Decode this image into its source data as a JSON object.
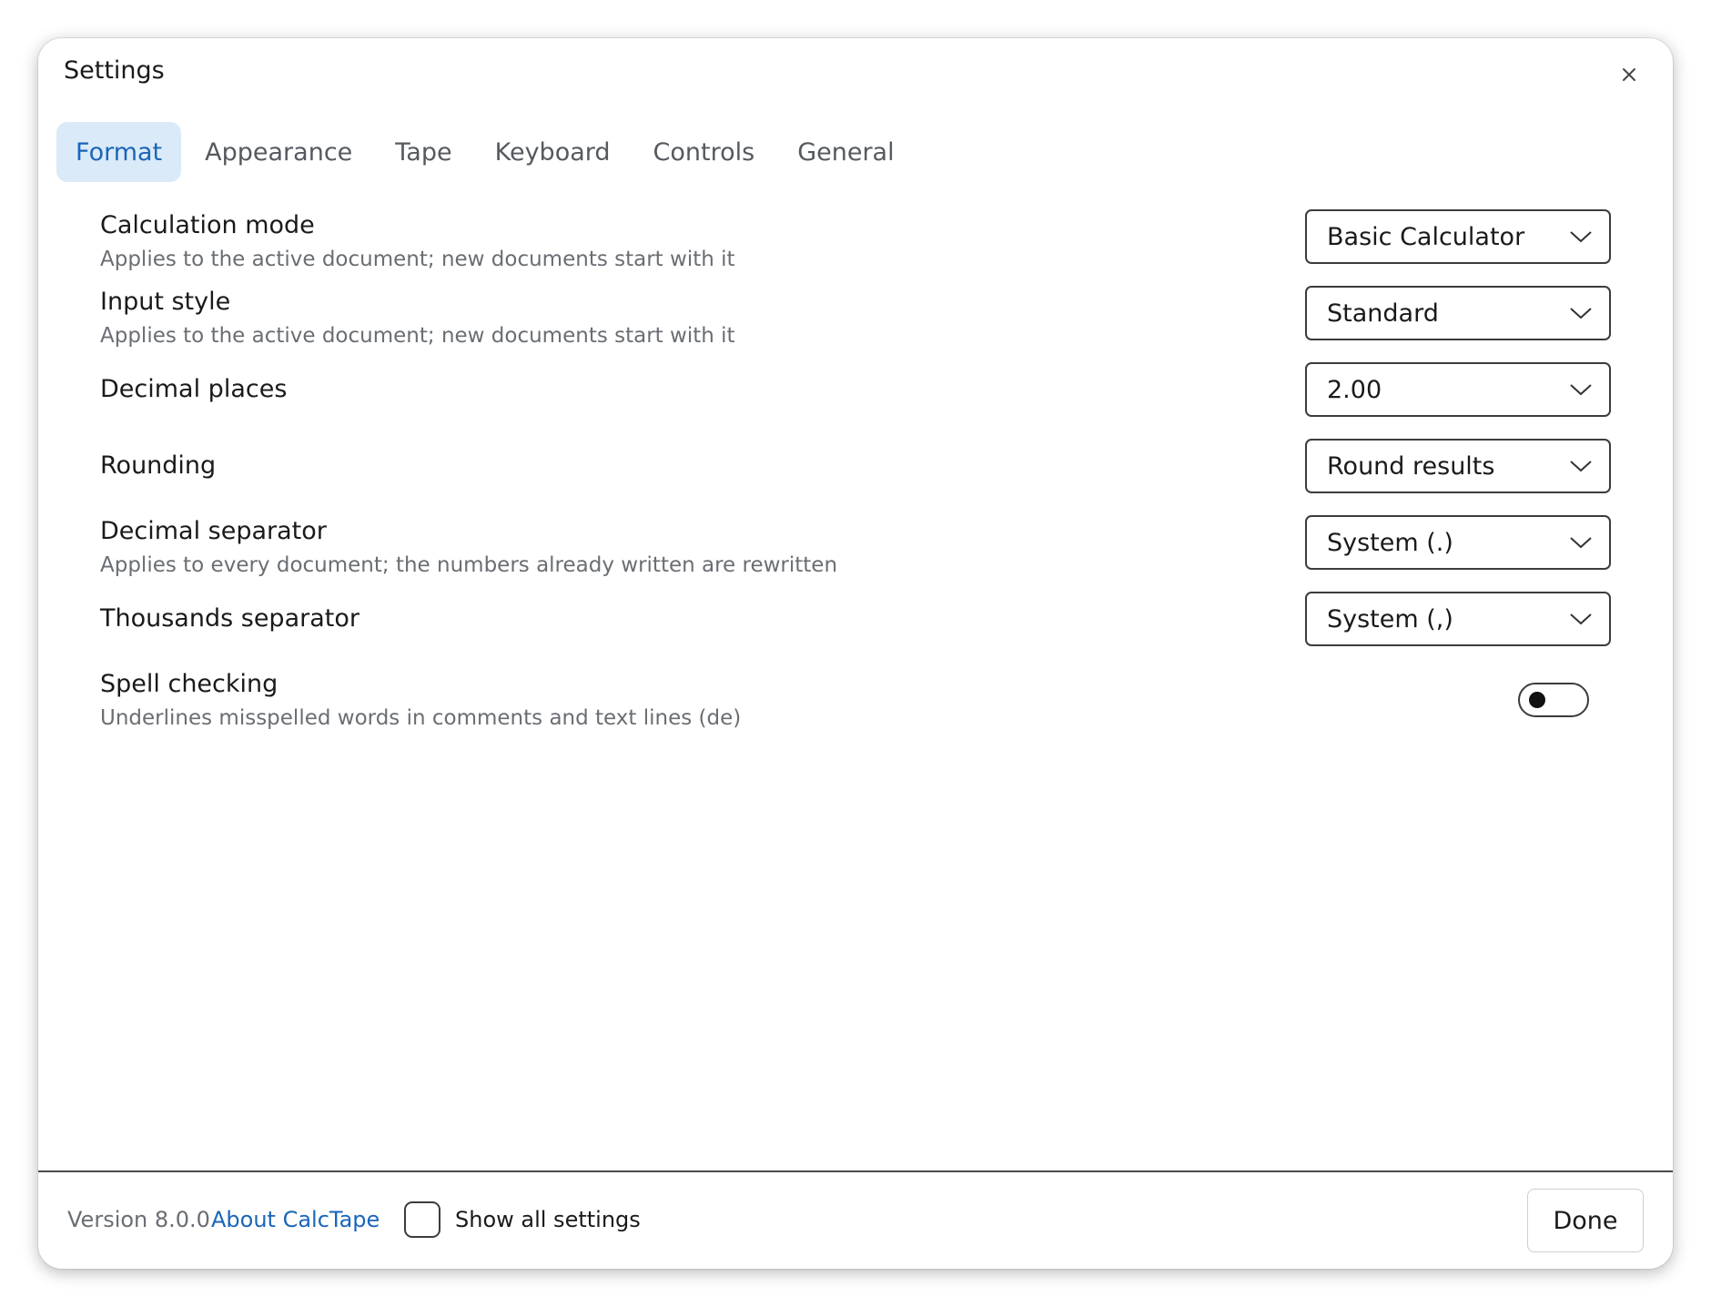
{
  "dialog": {
    "title": "Settings",
    "close_icon": "close-icon"
  },
  "tabs": [
    {
      "label": "Format",
      "active": true
    },
    {
      "label": "Appearance",
      "active": false
    },
    {
      "label": "Tape",
      "active": false
    },
    {
      "label": "Keyboard",
      "active": false
    },
    {
      "label": "Controls",
      "active": false
    },
    {
      "label": "General",
      "active": false
    }
  ],
  "settings": {
    "calculation_mode": {
      "label": "Calculation mode",
      "description": "Applies to the active document; new documents start with it",
      "value": "Basic Calculator"
    },
    "input_style": {
      "label": "Input style",
      "description": "Applies to the active document; new documents start with it",
      "value": "Standard"
    },
    "decimal_places": {
      "label": "Decimal places",
      "value": "2.00"
    },
    "rounding": {
      "label": "Rounding",
      "value": "Round results"
    },
    "decimal_separator": {
      "label": "Decimal separator",
      "description": "Applies to every document; the numbers already written are rewritten",
      "value": "System (.)"
    },
    "thousands_separator": {
      "label": "Thousands separator",
      "value": "System (,)"
    },
    "spell_checking": {
      "label": "Spell checking",
      "description": "Underlines misspelled words in comments and text lines (de)",
      "enabled": false
    }
  },
  "footer": {
    "version": "Version 8.0.0",
    "about_link": "About CalcTape",
    "show_all_label": "Show all settings",
    "show_all_checked": false,
    "done_label": "Done"
  },
  "colors": {
    "accent": "#1a66b8",
    "active_tab_bg": "#dbeaf9",
    "muted_text": "#6a6e73",
    "border": "#3c3c3c"
  }
}
